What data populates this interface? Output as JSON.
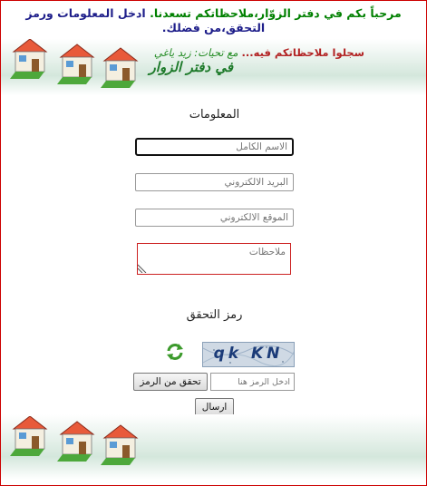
{
  "header": {
    "welcome": "مرحباً بكم في دفتر الزوّار،ملاحظاتكم تسعدنا.",
    "instruction": "ادخل المعلومات ورمز التحقق،من فضلك."
  },
  "banner": {
    "slogan_red": "سجلوا ملاحظاتكم فيه...",
    "slogan_green": "مع تحيات: زيد ياغي",
    "logo_text": "في دفتر الزوار"
  },
  "form": {
    "info_title": "المعلومات",
    "name_placeholder": "الاسم الكامل",
    "email_placeholder": "البريد الالكتروني",
    "website_placeholder": "الموقع الالكتروني",
    "notes_placeholder": "ملاحظات"
  },
  "captcha": {
    "title": "رمز التحقق",
    "code": "qk KN",
    "input_placeholder": "ادخل الرمز هنا",
    "verify_label": "تحقق من الرمز",
    "refresh_icon": "refresh-arrows-icon"
  },
  "actions": {
    "send_label": "ارسال"
  },
  "colors": {
    "welcome": "#008000",
    "instruction": "#1e1e8a",
    "border": "#cc0000",
    "banner_fade": "#d4e7dc"
  }
}
